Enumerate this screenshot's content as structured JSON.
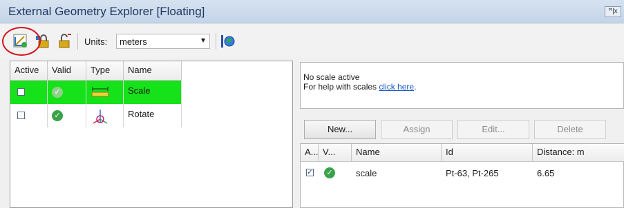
{
  "window": {
    "title": "External Geometry Explorer [Floating]",
    "pin_label": "ꟸ|x"
  },
  "toolbar": {
    "units_label": "Units:",
    "units_value": "meters"
  },
  "geometry_grid": {
    "columns": [
      "Active",
      "Valid",
      "Type",
      "Name"
    ],
    "rows": [
      {
        "active": false,
        "valid": true,
        "type_icon": "scale-type-icon",
        "name": "Scale",
        "selected": true
      },
      {
        "active": false,
        "valid": true,
        "type_icon": "rotate-type-icon",
        "name": "Rotate",
        "selected": false
      }
    ]
  },
  "scale_panel": {
    "message_line1": "No scale active",
    "message_line2_prefix": "For help with scales ",
    "message_link": "click here",
    "message_line2_suffix": ".",
    "buttons": {
      "new": "New...",
      "assign": "Assign",
      "edit": "Edit...",
      "delete": "Delete"
    },
    "list": {
      "columns": [
        "A...",
        "V...",
        "Name",
        "Id",
        "Distance: m"
      ],
      "rows": [
        {
          "active": true,
          "valid": true,
          "name": "scale",
          "id": "Pt-63, Pt-265",
          "distance": "6.65"
        }
      ]
    }
  },
  "colors": {
    "selected_row": "#16e21a",
    "highlight_circle": "#d4141c",
    "link": "#1a57c8"
  }
}
